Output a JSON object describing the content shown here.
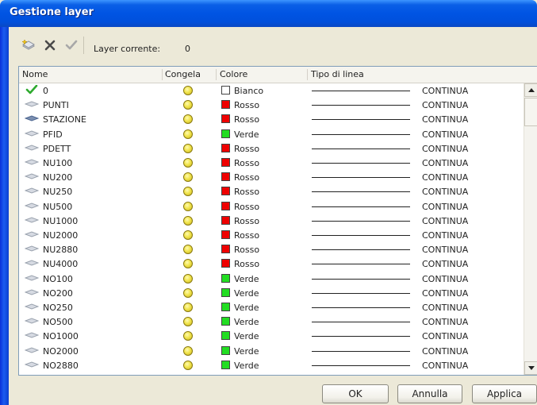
{
  "window": {
    "title": "Gestione layer"
  },
  "toolbar": {
    "new_layer_icon": "new-layer-icon",
    "delete_icon": "delete-x-icon",
    "set_current_icon": "checkmark-icon",
    "current_label": "Layer corrente:",
    "current_value": "0"
  },
  "columns": {
    "name": "Nome",
    "freeze": "Congela",
    "color": "Colore",
    "linetype": "Tipo di linea"
  },
  "colors": {
    "Bianco": "#ffffff",
    "Rosso": "#ee0000",
    "Verde": "#22dd22"
  },
  "rows": [
    {
      "name": "0",
      "color": "Bianco",
      "linetype": "CONTINUA",
      "current": true
    },
    {
      "name": "PUNTI",
      "color": "Rosso",
      "linetype": "CONTINUA"
    },
    {
      "name": "STAZIONE",
      "color": "Rosso",
      "linetype": "CONTINUA",
      "icon_dark": true
    },
    {
      "name": "PFID",
      "color": "Verde",
      "linetype": "CONTINUA"
    },
    {
      "name": "PDETT",
      "color": "Rosso",
      "linetype": "CONTINUA"
    },
    {
      "name": "NU100",
      "color": "Rosso",
      "linetype": "CONTINUA"
    },
    {
      "name": "NU200",
      "color": "Rosso",
      "linetype": "CONTINUA"
    },
    {
      "name": "NU250",
      "color": "Rosso",
      "linetype": "CONTINUA"
    },
    {
      "name": "NU500",
      "color": "Rosso",
      "linetype": "CONTINUA"
    },
    {
      "name": "NU1000",
      "color": "Rosso",
      "linetype": "CONTINUA"
    },
    {
      "name": "NU2000",
      "color": "Rosso",
      "linetype": "CONTINUA"
    },
    {
      "name": "NU2880",
      "color": "Rosso",
      "linetype": "CONTINUA"
    },
    {
      "name": "NU4000",
      "color": "Rosso",
      "linetype": "CONTINUA"
    },
    {
      "name": "NO100",
      "color": "Verde",
      "linetype": "CONTINUA"
    },
    {
      "name": "NO200",
      "color": "Verde",
      "linetype": "CONTINUA"
    },
    {
      "name": "NO250",
      "color": "Verde",
      "linetype": "CONTINUA"
    },
    {
      "name": "NO500",
      "color": "Verde",
      "linetype": "CONTINUA"
    },
    {
      "name": "NO1000",
      "color": "Verde",
      "linetype": "CONTINUA"
    },
    {
      "name": "NO2000",
      "color": "Verde",
      "linetype": "CONTINUA"
    },
    {
      "name": "NO2880",
      "color": "Verde",
      "linetype": "CONTINUA"
    }
  ],
  "buttons": {
    "ok": "OK",
    "cancel": "Annulla",
    "apply": "Applica"
  }
}
